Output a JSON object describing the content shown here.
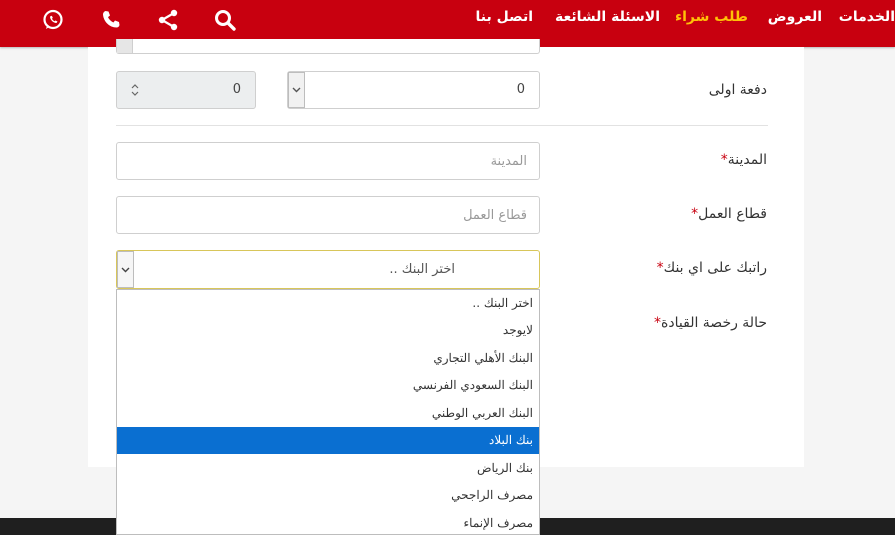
{
  "nav": {
    "items": [
      "الخدمات",
      "العروض",
      "طلب شراء",
      "الاسئلة الشائعة",
      "اتصل بنا"
    ],
    "active_index": 2,
    "icons": [
      "whatsapp-icon",
      "phone-icon",
      "share-icon",
      "search-icon"
    ],
    "accent": "#c8000f",
    "active_color": "#ffc107"
  },
  "form": {
    "down_payment": {
      "label": "دفعة اولى",
      "value": "0",
      "percent": "0"
    },
    "city": {
      "label": "المدينة",
      "required_mark": "*",
      "placeholder": "المدينة"
    },
    "sector": {
      "label": "قطاع العمل",
      "required_mark": "*",
      "placeholder": "قطاع العمل"
    },
    "bank": {
      "label": "راتبك على اي بنك",
      "required_mark": "*",
      "selected": "اختر البنك .."
    },
    "license": {
      "label": "حالة رخصة القيادة",
      "required_mark": "*"
    }
  },
  "bank_options": [
    "اختر البنك ..",
    "لايوجد",
    "البنك الأهلي التجاري",
    "البنك السعودي الفرنسي",
    "البنك العربي الوطني",
    "بنك البلاد",
    "بنك الرياض",
    "مصرف الراجحي",
    "مصرف الإنماء"
  ],
  "highlighted_option_index": 5,
  "highlight_color": "#0a6fd1"
}
